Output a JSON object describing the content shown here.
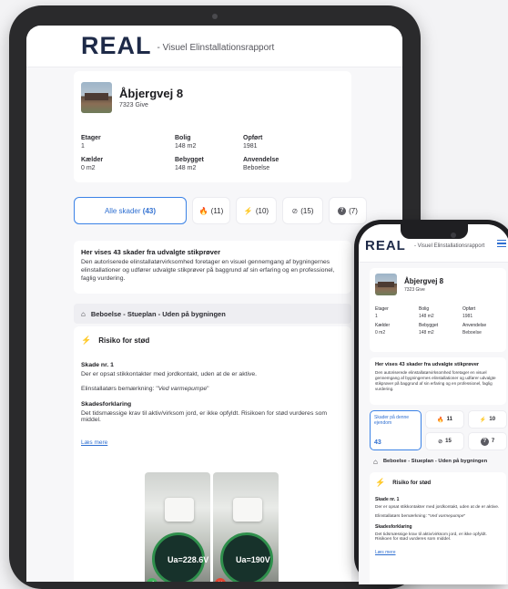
{
  "app": {
    "logo": "REAL",
    "subtitle": "- Visuel Elinstallationsrapport",
    "subtitle_mobile": "- Visuel Elinstallationsrapport"
  },
  "property": {
    "address": "Åbjergvej 8",
    "city": "7323 Give",
    "facts": [
      {
        "label": "Etager",
        "value": "1"
      },
      {
        "label": "Bolig",
        "value": "148 m2"
      },
      {
        "label": "Opført",
        "value": "1981"
      },
      {
        "label": "Kælder",
        "value": "0 m2"
      },
      {
        "label": "Bebygget",
        "value": "148 m2"
      },
      {
        "label": "Anvendelse",
        "value": "Beboelse"
      }
    ]
  },
  "filters": {
    "all_label": "Alle skader",
    "all_count": "(43)",
    "fire_count": "(11)",
    "bolt_count": "(10)",
    "ban_count": "(15)",
    "q_count": "(7)"
  },
  "filters_mobile": {
    "all_label": "Skader på denne ejendom",
    "all_count": "43",
    "fire_count": "11",
    "bolt_count": "10",
    "ban_count": "15",
    "q_count": "7"
  },
  "info": {
    "title": "Her vises 43 skader fra udvalgte stikprøver",
    "text": "Den autoriserede elinstallatørvirksomhed foretager en visuel gennemgang af bygningernes elinstallationer og udfører udvalgte stikprøver på baggrund af sin erfaring og en professionel, faglig vurdering."
  },
  "section": {
    "title": "Beboelse - Stueplan - Uden på bygningen"
  },
  "risk": {
    "title": "Risiko for stød",
    "damage_label": "Skade nr. 1",
    "damage_text": "Der er opsat stikkontakter med jordkontakt, uden at de er aktive.",
    "remark_prefix": "Elinstallatørs bemærkning: \"",
    "remark_value": "Ved varmepumpe",
    "remark_suffix": "\"",
    "explain_label": "Skadesforklaring",
    "explain_text": "Det tidsmæssige krav til aktiv/virksom jord, er ikke opfyldt. Risikoen for stød vurderes som middel.",
    "read_more": "Læs mere"
  },
  "photos": [
    {
      "reading": "Ua=228.6V"
    },
    {
      "reading": "Ua=190V"
    }
  ],
  "icons": {
    "fire": "fire-icon",
    "bolt": "bolt-icon",
    "ban": "ban-icon",
    "question": "question-icon",
    "home": "home-icon",
    "menu": "menu-icon"
  },
  "colors": {
    "brand": "#1e2a48",
    "accent": "#2f6fd1",
    "fire": "#e5432f",
    "bolt": "#f4b13a"
  }
}
